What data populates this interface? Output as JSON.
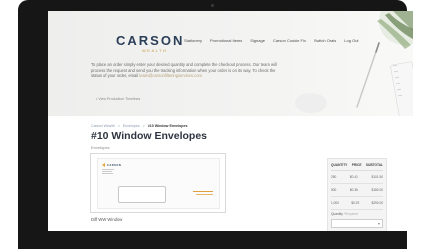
{
  "header": {
    "brand": "CARSON",
    "brand_sub": "WEALTH",
    "nav": [
      "Stationery",
      "Promotional Items",
      "Signage",
      "Carson Cookie Fix",
      "Switch Orals",
      "Log Out"
    ]
  },
  "intro": {
    "text": "To place an order simply enter your desired quantity and complete the checkout process. Our team will process the request and send you the tracking information when your order is on its way. To check the status of your order, email ",
    "email": "team@carsonfilteringservices.com",
    "link": "View Production Timelines"
  },
  "breadcrumb": [
    "Carson Wealth",
    "Envelopes",
    "#10 Window Envelopes"
  ],
  "product": {
    "title": "#10 Window Envelopes",
    "category": "Envelopes",
    "image_caption": "Diff WW Window",
    "envelope_logo": "CARSON"
  },
  "pricing": {
    "headers": [
      "QUANTITY",
      "PRICE",
      "SUBTOTAL"
    ],
    "rows": [
      [
        "250",
        "$0.41",
        "$101.50"
      ],
      [
        "500",
        "$0.36",
        "$180.00"
      ],
      [
        "1,000",
        "$0.29",
        "$290.00"
      ]
    ],
    "quantity_label": "Quantity",
    "quantity_hint": "*Required"
  },
  "colors": {
    "brand_navy": "#2c3e57",
    "brand_gold": "#c79a3e"
  }
}
